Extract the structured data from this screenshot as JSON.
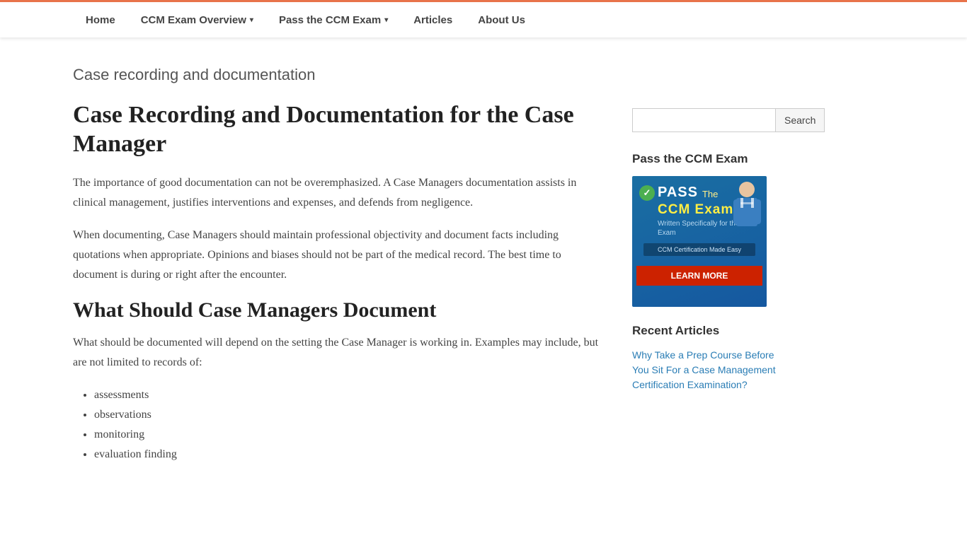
{
  "nav": {
    "items": [
      {
        "label": "Home",
        "has_dropdown": false
      },
      {
        "label": "CCM Exam Overview",
        "has_dropdown": true
      },
      {
        "label": "Pass the CCM Exam",
        "has_dropdown": true
      },
      {
        "label": "Articles",
        "has_dropdown": false
      },
      {
        "label": "About Us",
        "has_dropdown": false
      }
    ]
  },
  "main": {
    "page_title": "Case recording and documentation",
    "article_title": "Case Recording and Documentation for the Case Manager",
    "paragraph1": "The importance of good documentation can not be overemphasized. A Case Managers documentation assists in clinical management, justifies interventions and expenses, and defends from negligence.",
    "paragraph2": "When documenting, Case Managers should maintain professional objectivity and document facts including quotations when appropriate. Opinions and biases should not be part of the medical record. The best time to document is during or right after the encounter.",
    "section_title": "What Should Case Managers Document",
    "section_intro": "What should be documented will depend on the setting the Case Manager is working in. Examples may include, but are not limited to records of:",
    "bullet_items": [
      "assessments",
      "observations",
      "monitoring",
      "evaluation finding"
    ]
  },
  "sidebar": {
    "search_placeholder": "",
    "search_button_label": "Search",
    "pass_section_title": "Pass the CCM Exam",
    "banner": {
      "check": "✓",
      "pass": "PASS",
      "the": "The",
      "ccm_exam": "CCM Exam",
      "written_for": "Written Specifically for the CCM Exam",
      "cert_text": "CCM Certification Made Easy",
      "learn_more": "LEARN MORE"
    },
    "recent_articles_title": "Recent Articles",
    "recent_article_link": "Why Take a Prep Course Before You Sit For a Case Management Certification Examination?"
  }
}
